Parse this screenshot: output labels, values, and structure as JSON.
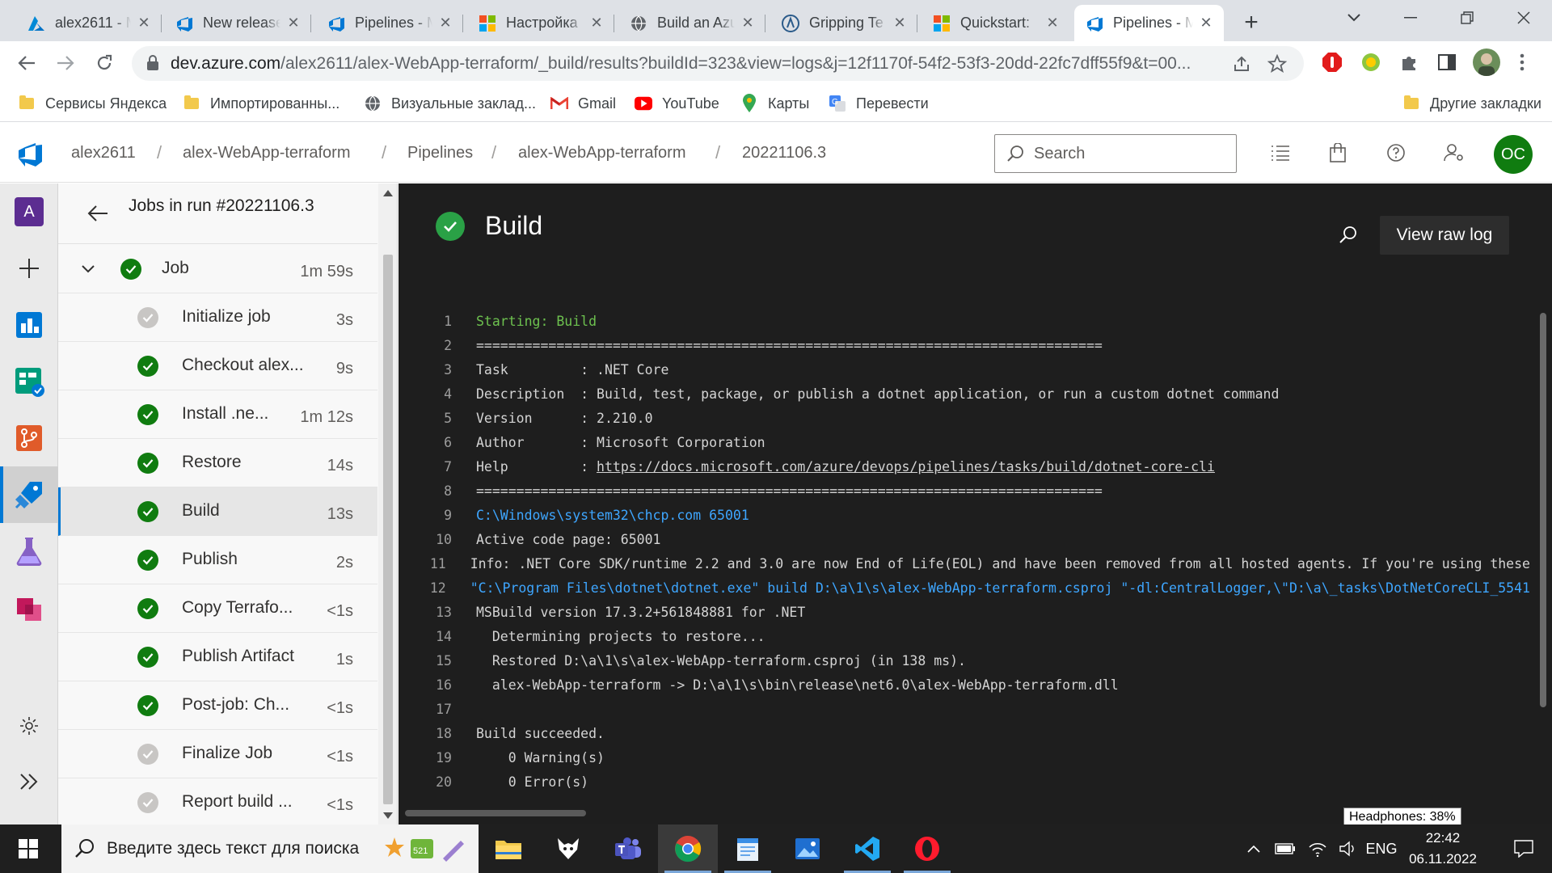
{
  "browser": {
    "tabs": [
      {
        "title": "alex2611 - M",
        "icon": "azure-icon"
      },
      {
        "title": "New release",
        "icon": "azure-devops-icon"
      },
      {
        "title": "Pipelines - M",
        "icon": "azure-devops-icon"
      },
      {
        "title": "Настройка",
        "icon": "microsoft-icon"
      },
      {
        "title": "Build an Azu",
        "icon": "globe-icon"
      },
      {
        "title": "Gripping Te",
        "icon": "gripping-icon"
      },
      {
        "title": "Quickstart:",
        "icon": "microsoft-icon"
      },
      {
        "title": "Pipelines - M",
        "icon": "azure-devops-icon"
      }
    ],
    "url_host": "dev.azure.com",
    "url_path": "/alex2611/alex-WebApp-terraform/_build/results?buildId=323&view=logs&j=12f1170f-54f2-53f3-20dd-22fc7dff55f9&t=00...",
    "bookmarks": [
      {
        "label": "Сервисы Яндекса"
      },
      {
        "label": "Импортированны..."
      },
      {
        "label": "Визуальные заклад..."
      },
      {
        "label": "Gmail"
      },
      {
        "label": "YouTube"
      },
      {
        "label": "Карты"
      },
      {
        "label": "Перевести"
      }
    ],
    "other_bookmarks": "Другие закладки"
  },
  "header": {
    "breadcrumb": [
      "alex2611",
      "alex-WebApp-terraform",
      "Pipelines",
      "alex-WebApp-terraform",
      "20221106.3"
    ],
    "search_placeholder": "Search",
    "avatar_initials": "OC"
  },
  "rail": {
    "org_initial": "A"
  },
  "jobs": {
    "title": "Jobs in run #20221106.3",
    "job": {
      "name": "Job",
      "duration": "1m 59s"
    },
    "steps": [
      {
        "name": "Initialize job",
        "duration": "3s",
        "status": "skipped"
      },
      {
        "name": "Checkout alex...",
        "duration": "9s",
        "status": "succeeded"
      },
      {
        "name": "Install .ne...",
        "duration": "1m 12s",
        "status": "succeeded"
      },
      {
        "name": "Restore",
        "duration": "14s",
        "status": "succeeded"
      },
      {
        "name": "Build",
        "duration": "13s",
        "status": "succeeded"
      },
      {
        "name": "Publish",
        "duration": "2s",
        "status": "succeeded"
      },
      {
        "name": "Copy Terrafo...",
        "duration": "<1s",
        "status": "succeeded"
      },
      {
        "name": "Publish Artifact",
        "duration": "1s",
        "status": "succeeded"
      },
      {
        "name": "Post-job: Ch...",
        "duration": "<1s",
        "status": "succeeded"
      },
      {
        "name": "Finalize Job",
        "duration": "<1s",
        "status": "skipped"
      },
      {
        "name": "Report build ...",
        "duration": "<1s",
        "status": "skipped"
      }
    ]
  },
  "log": {
    "title": "Build",
    "view_raw_label": "View raw log",
    "lines": [
      {
        "n": "1",
        "text": "Starting: Build",
        "style": "green"
      },
      {
        "n": "2",
        "text": "==============================================================================",
        "style": ""
      },
      {
        "n": "3",
        "text": "Task         : .NET Core",
        "style": ""
      },
      {
        "n": "4",
        "text": "Description  : Build, test, package, or publish a dotnet application, or run a custom dotnet command",
        "style": ""
      },
      {
        "n": "5",
        "text": "Version      : 2.210.0",
        "style": ""
      },
      {
        "n": "6",
        "text": "Author       : Microsoft Corporation",
        "style": ""
      },
      {
        "n": "7",
        "text": "Help         : ",
        "link": "https://docs.microsoft.com/azure/devops/pipelines/tasks/build/dotnet-core-cli",
        "style": ""
      },
      {
        "n": "8",
        "text": "==============================================================================",
        "style": ""
      },
      {
        "n": "9",
        "text": "C:\\Windows\\system32\\chcp.com 65001",
        "style": "blue"
      },
      {
        "n": "10",
        "text": "Active code page: 65001",
        "style": ""
      },
      {
        "n": "11",
        "text": "Info: .NET Core SDK/runtime 2.2 and 3.0 are now End of Life(EOL) and have been removed from all hosted agents. If you're using these",
        "style": ""
      },
      {
        "n": "12",
        "text": "\"C:\\Program Files\\dotnet\\dotnet.exe\" build D:\\a\\1\\s\\alex-WebApp-terraform.csproj \"-dl:CentralLogger,\\\"D:\\a\\_tasks\\DotNetCoreCLI_5541",
        "style": "blue"
      },
      {
        "n": "13",
        "text": "MSBuild version 17.3.2+561848881 for .NET",
        "style": ""
      },
      {
        "n": "14",
        "text": "  Determining projects to restore...",
        "style": ""
      },
      {
        "n": "15",
        "text": "  Restored D:\\a\\1\\s\\alex-WebApp-terraform.csproj (in 138 ms).",
        "style": ""
      },
      {
        "n": "16",
        "text": "  alex-WebApp-terraform -> D:\\a\\1\\s\\bin\\release\\net6.0\\alex-WebApp-terraform.dll",
        "style": ""
      },
      {
        "n": "17",
        "text": "",
        "style": ""
      },
      {
        "n": "18",
        "text": "Build succeeded.",
        "style": ""
      },
      {
        "n": "19",
        "text": "    0 Warning(s)",
        "style": ""
      },
      {
        "n": "20",
        "text": "    0 Error(s)",
        "style": ""
      }
    ]
  },
  "tooltip": "Headphones: 38%",
  "taskbar": {
    "search_placeholder": "Введите здесь текст для поиска",
    "language": "ENG",
    "time": "22:42",
    "date": "06.11.2022"
  },
  "colors": {
    "success": "#107c10",
    "accent": "#0078d4",
    "log_bg": "#1e1e1e"
  }
}
